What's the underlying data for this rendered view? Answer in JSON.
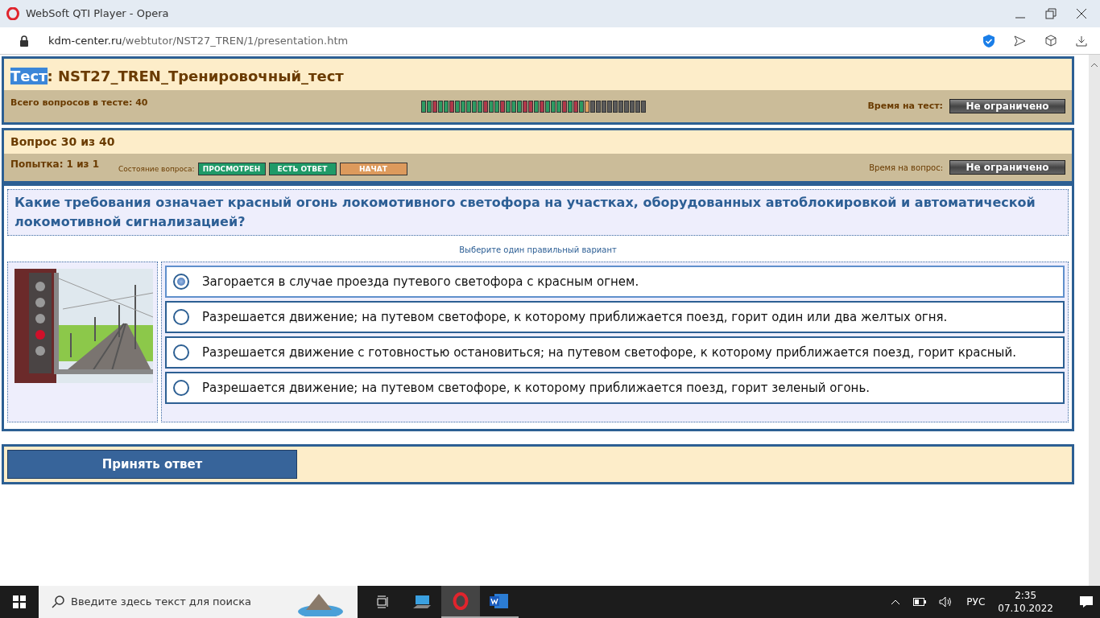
{
  "window": {
    "title": "WebSoft QTI Player - Opera"
  },
  "address_bar": {
    "host": "kdm-center.ru",
    "path": "/webtutor/NST27_TREN/1/presentation.htm"
  },
  "test": {
    "title_prefix": "Тест",
    "title_prefix_highlighted": true,
    "title_rest": ": NST27_TREN_Тренировочный_тест",
    "total_label": "Всего вопросов в тесте: 40",
    "time_label": "Время на тест:",
    "time_value": "Не ограничено",
    "progress": [
      {
        "color": "#2e9a62"
      },
      {
        "color": "#2e9a62"
      },
      {
        "color": "#b0384a"
      },
      {
        "color": "#2e9a62"
      },
      {
        "color": "#2e9a62"
      },
      {
        "color": "#b0384a"
      },
      {
        "color": "#2e9a62"
      },
      {
        "color": "#2e9a62"
      },
      {
        "color": "#2e9a62"
      },
      {
        "color": "#2e9a62"
      },
      {
        "color": "#2e9a62"
      },
      {
        "color": "#b0384a"
      },
      {
        "color": "#2e9a62"
      },
      {
        "color": "#2e9a62"
      },
      {
        "color": "#b0384a"
      },
      {
        "color": "#2e9a62"
      },
      {
        "color": "#2e9a62"
      },
      {
        "color": "#2e9a62"
      },
      {
        "color": "#b0384a"
      },
      {
        "color": "#b0384a"
      },
      {
        "color": "#2e9a62"
      },
      {
        "color": "#b0384a"
      },
      {
        "color": "#2e9a62"
      },
      {
        "color": "#2e9a62"
      },
      {
        "color": "#2e9a62"
      },
      {
        "color": "#b0384a"
      },
      {
        "color": "#2e9a62"
      },
      {
        "color": "#b0384a"
      },
      {
        "color": "#2e9a62"
      },
      {
        "color": "#e0a060"
      },
      {
        "color": "#5a5a5a"
      },
      {
        "color": "#5a5a5a"
      },
      {
        "color": "#5a5a5a"
      },
      {
        "color": "#5a5a5a"
      },
      {
        "color": "#5a5a5a"
      },
      {
        "color": "#5a5a5a"
      },
      {
        "color": "#5a5a5a"
      },
      {
        "color": "#5a5a5a"
      },
      {
        "color": "#5a5a5a"
      },
      {
        "color": "#5a5a5a"
      }
    ]
  },
  "question_header": {
    "title": "Вопрос 30 из 40",
    "attempt": "Попытка: 1 из 1",
    "state_label": "Состояние вопроса:",
    "states": [
      {
        "label": "ПРОСМОТРЕН",
        "color": "#1f9a68"
      },
      {
        "label": "ЕСТЬ ОТВЕТ",
        "color": "#1f9a68"
      },
      {
        "label": "НАЧАТ",
        "color": "#dd9a5c"
      }
    ],
    "time_label": "Время на вопрос:",
    "time_value": "Не ограничено"
  },
  "question": {
    "text": "Какие требования означает красный огонь локомотивного светофора на участках, оборудованных автоблокировкой и автоматической локомотивной сигнализацией?",
    "hint": "Выберите один правильный вариант",
    "options": [
      {
        "text": "Загорается в случае проезда путевого светофора с красным огнем.",
        "selected": true
      },
      {
        "text": "Разрешается движение; на путевом светофоре, к которому приближается поезд, горит один или два желтых огня.",
        "selected": false
      },
      {
        "text": "Разрешается движение с готовностью остановиться; на путевом светофоре, к которому приближается поезд, горит красный.",
        "selected": false
      },
      {
        "text": "Разрешается движение; на путевом светофоре, к которому приближается поезд, горит зеленый огонь.",
        "selected": false
      }
    ]
  },
  "submit": {
    "label": "Принять ответ"
  },
  "taskbar": {
    "search_placeholder": "Введите здесь текст для поиска",
    "language": "РУС",
    "time": "2:35",
    "date": "07.10.2022"
  }
}
